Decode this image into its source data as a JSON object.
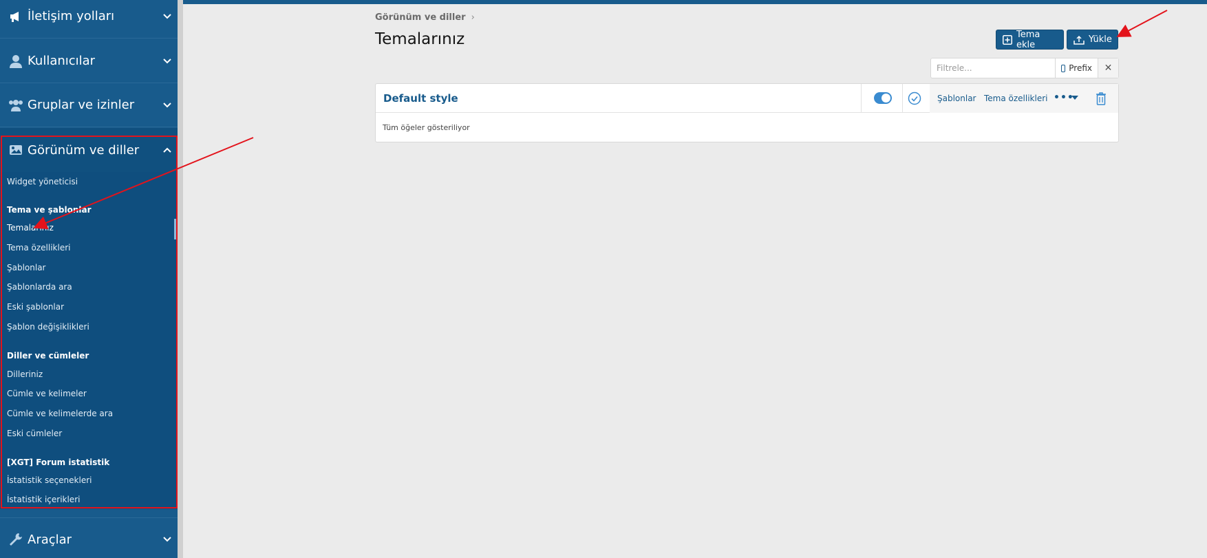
{
  "sidebar": {
    "headers": [
      {
        "label": "İletişim yolları",
        "icon": "megaphone-icon"
      },
      {
        "label": "Kullanıcılar",
        "icon": "user-icon"
      },
      {
        "label": "Gruplar ve izinler",
        "icon": "users-icon"
      },
      {
        "label": "Görünüm ve diller",
        "icon": "image-icon"
      },
      {
        "label": "Araçlar",
        "icon": "wrench-icon"
      }
    ],
    "links": {
      "widget": "Widget yöneticisi",
      "group1": "Tema ve şablonlar",
      "temalariniz": "Temalarınız",
      "tema_ozellikleri": "Tema özellikleri",
      "sablonlar": "Şablonlar",
      "sablonlarda_ara": "Şablonlarda ara",
      "eski_sablonlar": "Eski şablonlar",
      "sablon_degisiklikleri": "Şablon değişiklikleri",
      "group2": "Diller ve cümleler",
      "dilleriniz": "Dilleriniz",
      "cumle_kelimeler": "Cümle ve kelimeler",
      "cumle_ara": "Cümle ve kelimelerde ara",
      "eski_cumleler": "Eski cümleler",
      "group3": "[XGT] Forum istatistik",
      "istatistik_secenekleri": "İstatistik seçenekleri",
      "istatistik_icerikleri": "İstatistik içerikleri"
    }
  },
  "breadcrumb": {
    "item": "Görünüm ve diller",
    "separator": "›"
  },
  "page_title": "Temalarınız",
  "buttons": {
    "add_theme": "Tema ekle",
    "upload": "Yükle"
  },
  "filter": {
    "placeholder": "Filtrele...",
    "prefix_label": "Prefix",
    "clear": "✕"
  },
  "styles_list": {
    "rows": [
      {
        "title": "Default style",
        "enabled": true,
        "templates_link": "Şablonlar",
        "properties_link": "Tema özellikleri",
        "more": "•••"
      }
    ],
    "footer": "Tüm öğeler gösteriliyor"
  },
  "colors": {
    "sidebar": "#185b8c",
    "accent": "#185b8c",
    "annotation": "#e3131b",
    "toggle": "#3a8bd0"
  }
}
